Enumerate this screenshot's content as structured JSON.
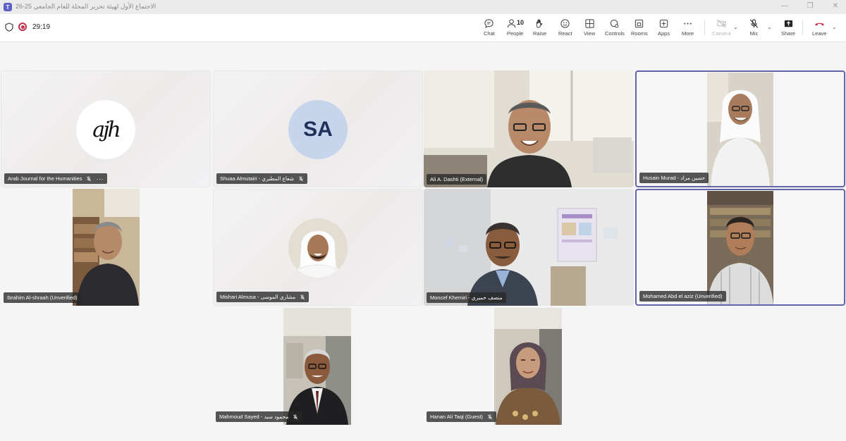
{
  "window": {
    "title": "الاجتماع الأول لهيئة تحرير المجلة للعام الجامعي 25-26",
    "controls": [
      "minimize-icon",
      "restore-icon",
      "close-icon"
    ]
  },
  "toolbar": {
    "timer": "29:19",
    "items": [
      {
        "label": "Chat",
        "icon": "chat-icon"
      },
      {
        "label": "People",
        "icon": "people-icon",
        "count": "10"
      },
      {
        "label": "Raise",
        "icon": "raise-hand-icon"
      },
      {
        "label": "React",
        "icon": "react-icon"
      },
      {
        "label": "View",
        "icon": "view-icon"
      },
      {
        "label": "Controls",
        "icon": "controls-icon"
      },
      {
        "label": "Rooms",
        "icon": "rooms-icon"
      },
      {
        "label": "Apps",
        "icon": "apps-icon"
      },
      {
        "label": "More",
        "icon": "more-icon"
      },
      {
        "label": "Camera",
        "icon": "camera-off-icon"
      },
      {
        "label": "Mic",
        "icon": "mic-off-icon"
      },
      {
        "label": "Share",
        "icon": "share-icon"
      },
      {
        "label": "Leave",
        "icon": "leave-icon"
      }
    ],
    "colors": {
      "recording": "#c4314b",
      "leave": "#c4314b",
      "active_border": "#6264a7"
    }
  },
  "participants": [
    {
      "name": "Arab Journal for the Humanities",
      "muted": true,
      "kind": "logo",
      "logo_text": "ajh"
    },
    {
      "name": "Shuaa Almutairi - شعاع المطيري",
      "muted": true,
      "kind": "initials",
      "initials": "SA"
    },
    {
      "name": "Ali A. Dashti (External)",
      "muted": false,
      "kind": "video"
    },
    {
      "name": "Husain Murad - حسين مراد",
      "muted": false,
      "kind": "video",
      "active": true
    },
    {
      "name": "Ibrahim Al-shraah (Unverified)",
      "muted": false,
      "kind": "video"
    },
    {
      "name": "Mishari Almusa - مشاري الموسى",
      "muted": true,
      "kind": "photo"
    },
    {
      "name": "Moncef Khemiri - منصف خميري",
      "muted": false,
      "kind": "video"
    },
    {
      "name": "Mohamed Abd el aziz (Unverified)",
      "muted": false,
      "kind": "video",
      "active": true
    },
    {
      "name": "Mahmoud Sayed - محمود سيد",
      "muted": true,
      "kind": "video"
    },
    {
      "name": "Hanan Ali Taqi (Guest)",
      "muted": true,
      "kind": "video"
    }
  ]
}
